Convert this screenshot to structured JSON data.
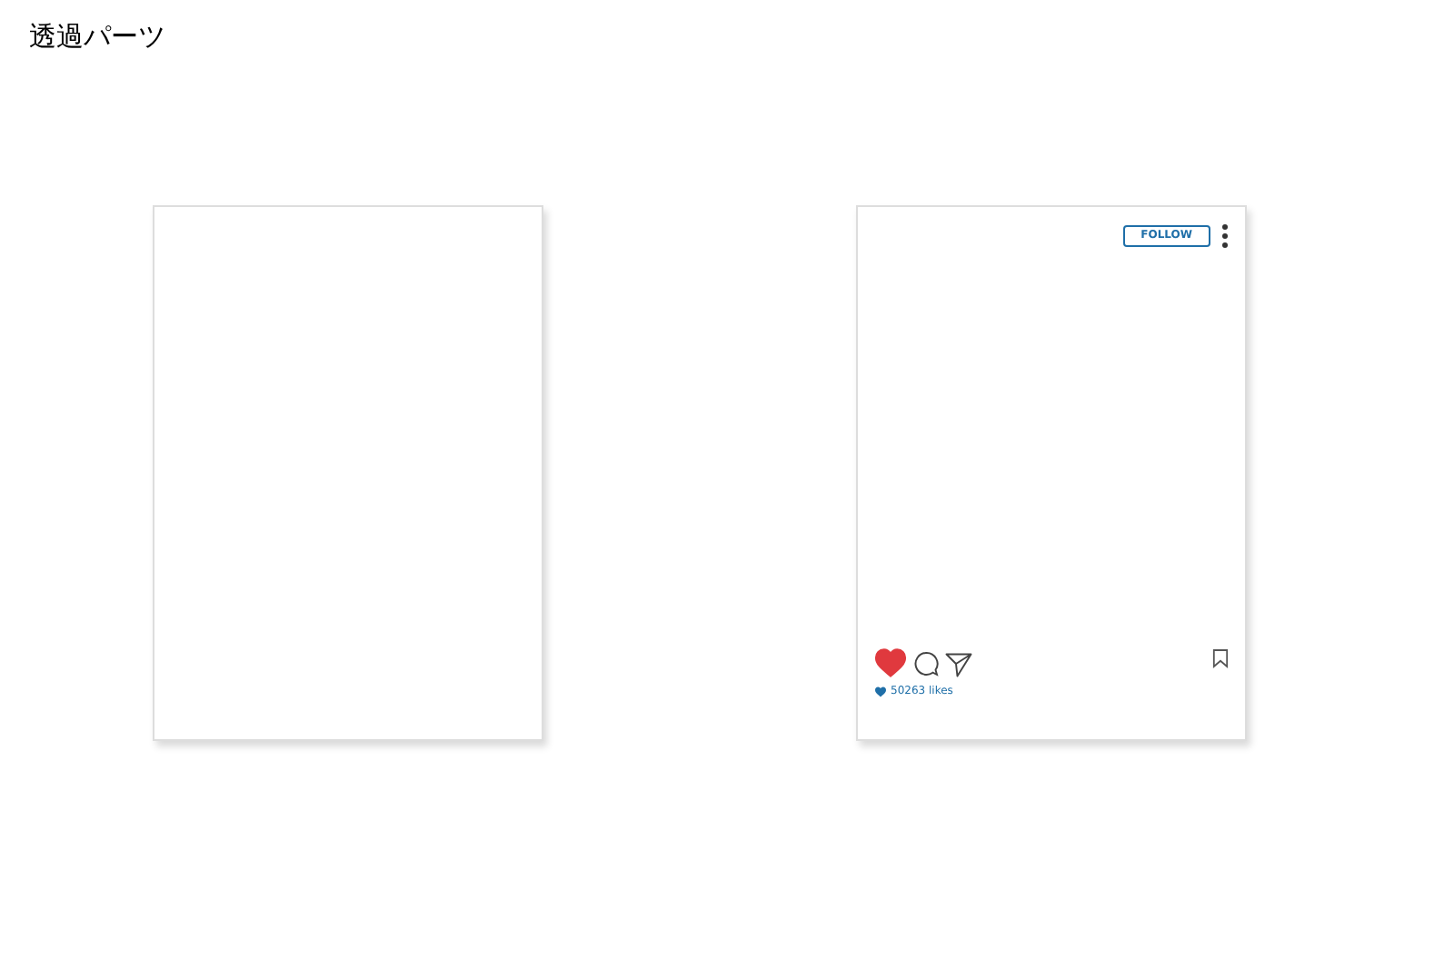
{
  "title": "透過パーツ",
  "cards": [
    {
      "kind": "blank"
    },
    {
      "kind": "post",
      "follow_label": "FOLLOW",
      "liked": true,
      "likes": "50263 likes"
    }
  ]
}
